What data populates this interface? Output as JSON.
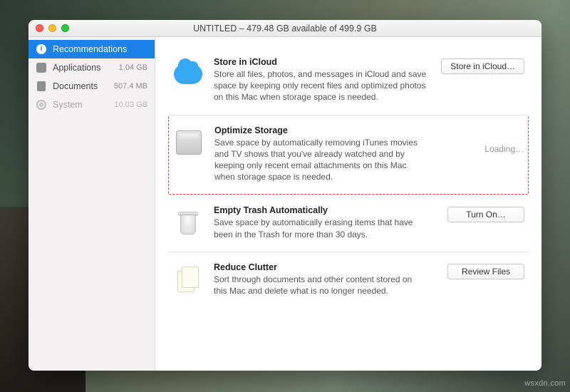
{
  "window": {
    "title": "UNTITLED – 479.48 GB available of 499.9 GB"
  },
  "sidebar": {
    "items": [
      {
        "icon": "info-icon",
        "label": "Recommendations",
        "size": "",
        "active": true
      },
      {
        "icon": "app-icon",
        "label": "Applications",
        "size": "1.04 GB",
        "active": false
      },
      {
        "icon": "document-icon",
        "label": "Documents",
        "size": "507.4 MB",
        "active": false
      },
      {
        "icon": "gear-icon",
        "label": "System",
        "size": "10.03 GB",
        "active": false,
        "dim": true
      }
    ]
  },
  "recommendations": [
    {
      "icon": "cloud-icon",
      "title": "Store in iCloud",
      "desc": "Store all files, photos, and messages in iCloud and save space by keeping only recent files and optimized photos on this Mac when storage space is needed.",
      "action_type": "button",
      "action_label": "Store in iCloud…"
    },
    {
      "icon": "drive-icon",
      "title": "Optimize Storage",
      "desc": "Save space by automatically removing iTunes movies and TV shows that you've already watched and by keeping only recent email attachments on this Mac when storage space is needed.",
      "action_type": "loading",
      "action_label": "Loading…",
      "highlight": true
    },
    {
      "icon": "trash-icon",
      "title": "Empty Trash Automatically",
      "desc": "Save space by automatically erasing items that have been in the Trash for more than 30 days.",
      "action_type": "button",
      "action_label": "Turn On…"
    },
    {
      "icon": "documents-icon",
      "title": "Reduce Clutter",
      "desc": "Sort through documents and other content stored on this Mac and delete what is no longer needed.",
      "action_type": "button",
      "action_label": "Review Files"
    }
  ],
  "watermark": "wsxdn.com"
}
